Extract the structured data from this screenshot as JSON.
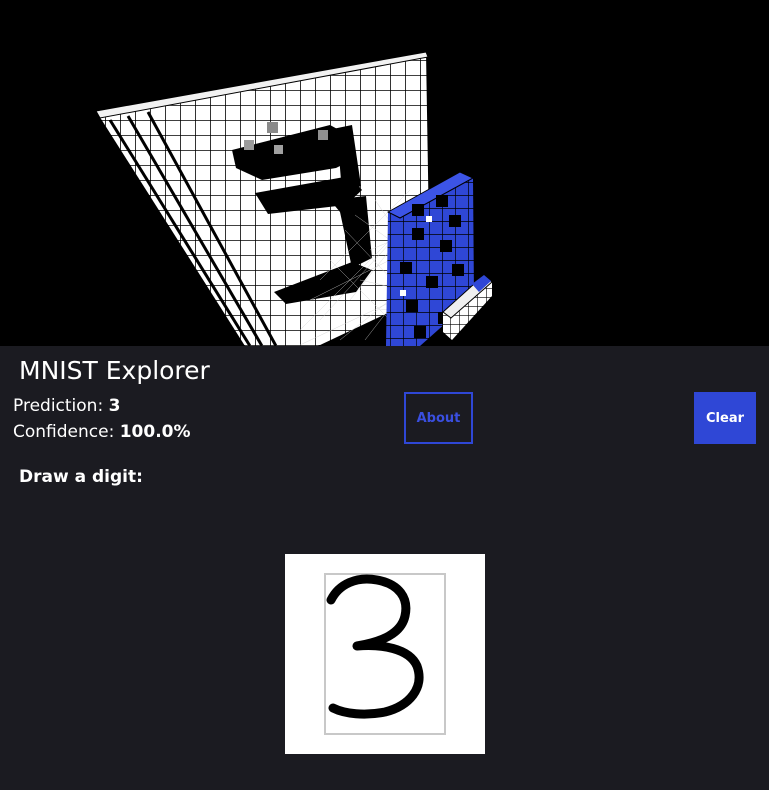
{
  "app": {
    "title": "MNIST Explorer"
  },
  "prediction": {
    "label": "Prediction:",
    "value": "3"
  },
  "confidence": {
    "label": "Confidence:",
    "value": "100.0%"
  },
  "buttons": {
    "about_label": "About",
    "clear_label": "Clear"
  },
  "drawing": {
    "prompt": "Draw a digit:",
    "stroke_color": "#000000",
    "guide_color": "#c8c8c8"
  },
  "colors": {
    "accent": "#2f47d6",
    "panel_bg": "#1b1b21",
    "viewport_bg": "#000000",
    "active_cube": "#2f47d6",
    "inactive_cube": "#ffffff"
  }
}
